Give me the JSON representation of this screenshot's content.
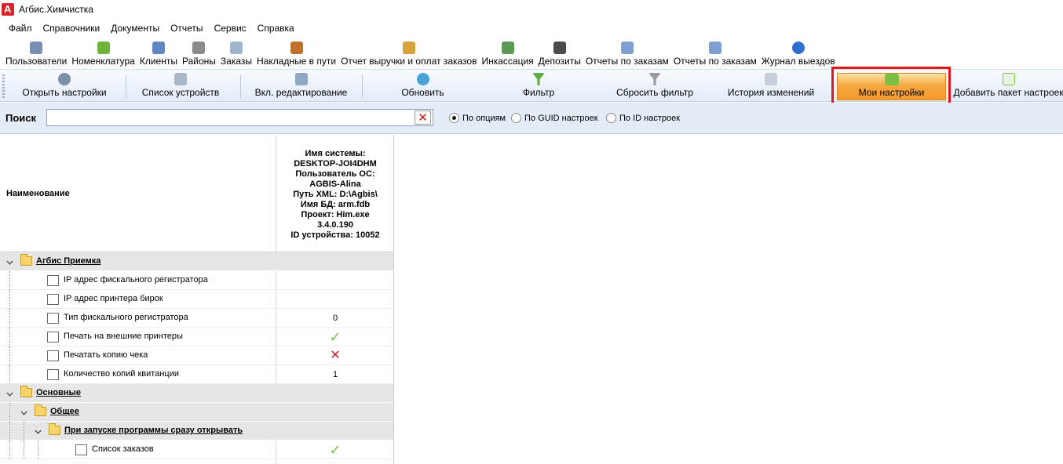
{
  "window": {
    "title": "Агбис.Химчистка"
  },
  "menu": [
    "Файл",
    "Справочники",
    "Документы",
    "Отчеты",
    "Сервис",
    "Справка"
  ],
  "toolbar_main": [
    {
      "label": "Пользователи",
      "icon": "users-icon",
      "color": "#7a8fb0"
    },
    {
      "label": "Номенклатура",
      "icon": "nomenclature-icon",
      "color": "#6fb33a"
    },
    {
      "label": "Клиенты",
      "icon": "clients-icon",
      "color": "#5f86c5"
    },
    {
      "label": "Районы",
      "icon": "districts-icon",
      "color": "#8a8a8a"
    },
    {
      "label": "Заказы",
      "icon": "orders-icon",
      "color": "#9fb3cc"
    },
    {
      "label": "Накладные в пути",
      "icon": "truck-icon",
      "color": "#c2702a"
    },
    {
      "label": "Отчет выручки и оплат заказов",
      "icon": "revenue-report-icon",
      "color": "#d8a43a"
    },
    {
      "label": "Инкассация",
      "icon": "cash-collection-icon",
      "color": "#5b9a55"
    },
    {
      "label": "Депозиты",
      "icon": "deposits-icon",
      "color": "#4c4c4c"
    },
    {
      "label": "Отчеты по заказам",
      "icon": "orders-report-icon",
      "color": "#7fa0cf"
    },
    {
      "label": "Отчеты по заказам",
      "icon": "orders-report-icon",
      "color": "#7fa0cf"
    },
    {
      "label": "Журнал выездов",
      "icon": "arrow-right-circle-icon",
      "color": "#2f6fd1"
    }
  ],
  "toolbar_settings": {
    "open_settings": "Открыть настройки",
    "device_list": "Список устройств",
    "enable_editing": "Вкл. редактирование",
    "refresh": "Обновить",
    "filter": "Фильтр",
    "reset_filter": "Сбросить фильтр",
    "change_history": "История изменений",
    "my_settings": "Мои настройки",
    "add_settings_package": "Добавить пакет настроек"
  },
  "search": {
    "label": "Поиск",
    "value": "",
    "options": [
      {
        "label": "По опциям",
        "selected": true
      },
      {
        "label": "По GUID настроек",
        "selected": false
      },
      {
        "label": "По ID настроек",
        "selected": false
      }
    ]
  },
  "grid": {
    "name_header": "Наименование",
    "device_header": [
      "Имя системы:",
      "DESKTOP-JOI4DHM",
      "Пользователь ОС:",
      "AGBIS-Alina",
      "Путь XML: D:\\Agbis\\",
      "Имя БД: arm.fdb",
      "Проект: Him.exe",
      "3.4.0.190",
      "ID устройства: 10052"
    ],
    "rows": [
      {
        "type": "group",
        "level": 0,
        "label": "Агбис Приемка",
        "value": ""
      },
      {
        "type": "item",
        "level": 1,
        "label": "IP адрес фискального регистратора",
        "value": ""
      },
      {
        "type": "item",
        "level": 1,
        "label": "IP адрес принтера бирок",
        "value": ""
      },
      {
        "type": "item",
        "level": 1,
        "label": "Тип фискального регистратора",
        "value": "0"
      },
      {
        "type": "item",
        "level": 1,
        "label": "Печать на внешние принтеры",
        "value": "check"
      },
      {
        "type": "item",
        "level": 1,
        "label": "Печатать копию чека",
        "value": "cross"
      },
      {
        "type": "item",
        "level": 1,
        "label": "Количество копий квитанции",
        "value": "1"
      },
      {
        "type": "group",
        "level": 0,
        "label": "Основные",
        "value": ""
      },
      {
        "type": "group",
        "level": 1,
        "label": "Общее",
        "value": ""
      },
      {
        "type": "group",
        "level": 2,
        "label": "При запуске программы сразу открывать",
        "value": ""
      },
      {
        "type": "item",
        "level": 3,
        "label": "Список заказов",
        "value": "check"
      }
    ]
  },
  "colors": {
    "highlight": "#e3161b",
    "active_button": "#f7a941",
    "check": "#7cc043",
    "cross": "#d0171d"
  }
}
